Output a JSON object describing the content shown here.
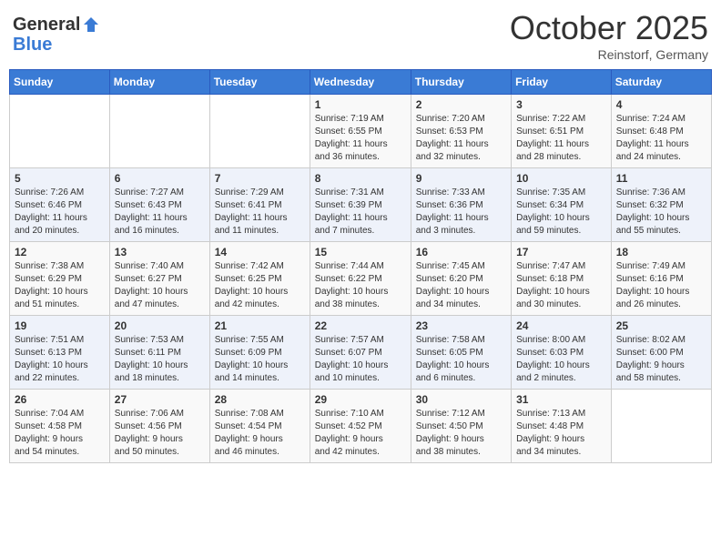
{
  "header": {
    "logo_general": "General",
    "logo_blue": "Blue",
    "month_title": "October 2025",
    "location": "Reinstorf, Germany"
  },
  "days_of_week": [
    "Sunday",
    "Monday",
    "Tuesday",
    "Wednesday",
    "Thursday",
    "Friday",
    "Saturday"
  ],
  "weeks": [
    [
      {
        "day": "",
        "info": ""
      },
      {
        "day": "",
        "info": ""
      },
      {
        "day": "",
        "info": ""
      },
      {
        "day": "1",
        "info": "Sunrise: 7:19 AM\nSunset: 6:55 PM\nDaylight: 11 hours\nand 36 minutes."
      },
      {
        "day": "2",
        "info": "Sunrise: 7:20 AM\nSunset: 6:53 PM\nDaylight: 11 hours\nand 32 minutes."
      },
      {
        "day": "3",
        "info": "Sunrise: 7:22 AM\nSunset: 6:51 PM\nDaylight: 11 hours\nand 28 minutes."
      },
      {
        "day": "4",
        "info": "Sunrise: 7:24 AM\nSunset: 6:48 PM\nDaylight: 11 hours\nand 24 minutes."
      }
    ],
    [
      {
        "day": "5",
        "info": "Sunrise: 7:26 AM\nSunset: 6:46 PM\nDaylight: 11 hours\nand 20 minutes."
      },
      {
        "day": "6",
        "info": "Sunrise: 7:27 AM\nSunset: 6:43 PM\nDaylight: 11 hours\nand 16 minutes."
      },
      {
        "day": "7",
        "info": "Sunrise: 7:29 AM\nSunset: 6:41 PM\nDaylight: 11 hours\nand 11 minutes."
      },
      {
        "day": "8",
        "info": "Sunrise: 7:31 AM\nSunset: 6:39 PM\nDaylight: 11 hours\nand 7 minutes."
      },
      {
        "day": "9",
        "info": "Sunrise: 7:33 AM\nSunset: 6:36 PM\nDaylight: 11 hours\nand 3 minutes."
      },
      {
        "day": "10",
        "info": "Sunrise: 7:35 AM\nSunset: 6:34 PM\nDaylight: 10 hours\nand 59 minutes."
      },
      {
        "day": "11",
        "info": "Sunrise: 7:36 AM\nSunset: 6:32 PM\nDaylight: 10 hours\nand 55 minutes."
      }
    ],
    [
      {
        "day": "12",
        "info": "Sunrise: 7:38 AM\nSunset: 6:29 PM\nDaylight: 10 hours\nand 51 minutes."
      },
      {
        "day": "13",
        "info": "Sunrise: 7:40 AM\nSunset: 6:27 PM\nDaylight: 10 hours\nand 47 minutes."
      },
      {
        "day": "14",
        "info": "Sunrise: 7:42 AM\nSunset: 6:25 PM\nDaylight: 10 hours\nand 42 minutes."
      },
      {
        "day": "15",
        "info": "Sunrise: 7:44 AM\nSunset: 6:22 PM\nDaylight: 10 hours\nand 38 minutes."
      },
      {
        "day": "16",
        "info": "Sunrise: 7:45 AM\nSunset: 6:20 PM\nDaylight: 10 hours\nand 34 minutes."
      },
      {
        "day": "17",
        "info": "Sunrise: 7:47 AM\nSunset: 6:18 PM\nDaylight: 10 hours\nand 30 minutes."
      },
      {
        "day": "18",
        "info": "Sunrise: 7:49 AM\nSunset: 6:16 PM\nDaylight: 10 hours\nand 26 minutes."
      }
    ],
    [
      {
        "day": "19",
        "info": "Sunrise: 7:51 AM\nSunset: 6:13 PM\nDaylight: 10 hours\nand 22 minutes."
      },
      {
        "day": "20",
        "info": "Sunrise: 7:53 AM\nSunset: 6:11 PM\nDaylight: 10 hours\nand 18 minutes."
      },
      {
        "day": "21",
        "info": "Sunrise: 7:55 AM\nSunset: 6:09 PM\nDaylight: 10 hours\nand 14 minutes."
      },
      {
        "day": "22",
        "info": "Sunrise: 7:57 AM\nSunset: 6:07 PM\nDaylight: 10 hours\nand 10 minutes."
      },
      {
        "day": "23",
        "info": "Sunrise: 7:58 AM\nSunset: 6:05 PM\nDaylight: 10 hours\nand 6 minutes."
      },
      {
        "day": "24",
        "info": "Sunrise: 8:00 AM\nSunset: 6:03 PM\nDaylight: 10 hours\nand 2 minutes."
      },
      {
        "day": "25",
        "info": "Sunrise: 8:02 AM\nSunset: 6:00 PM\nDaylight: 9 hours\nand 58 minutes."
      }
    ],
    [
      {
        "day": "26",
        "info": "Sunrise: 7:04 AM\nSunset: 4:58 PM\nDaylight: 9 hours\nand 54 minutes."
      },
      {
        "day": "27",
        "info": "Sunrise: 7:06 AM\nSunset: 4:56 PM\nDaylight: 9 hours\nand 50 minutes."
      },
      {
        "day": "28",
        "info": "Sunrise: 7:08 AM\nSunset: 4:54 PM\nDaylight: 9 hours\nand 46 minutes."
      },
      {
        "day": "29",
        "info": "Sunrise: 7:10 AM\nSunset: 4:52 PM\nDaylight: 9 hours\nand 42 minutes."
      },
      {
        "day": "30",
        "info": "Sunrise: 7:12 AM\nSunset: 4:50 PM\nDaylight: 9 hours\nand 38 minutes."
      },
      {
        "day": "31",
        "info": "Sunrise: 7:13 AM\nSunset: 4:48 PM\nDaylight: 9 hours\nand 34 minutes."
      },
      {
        "day": "",
        "info": ""
      }
    ]
  ]
}
